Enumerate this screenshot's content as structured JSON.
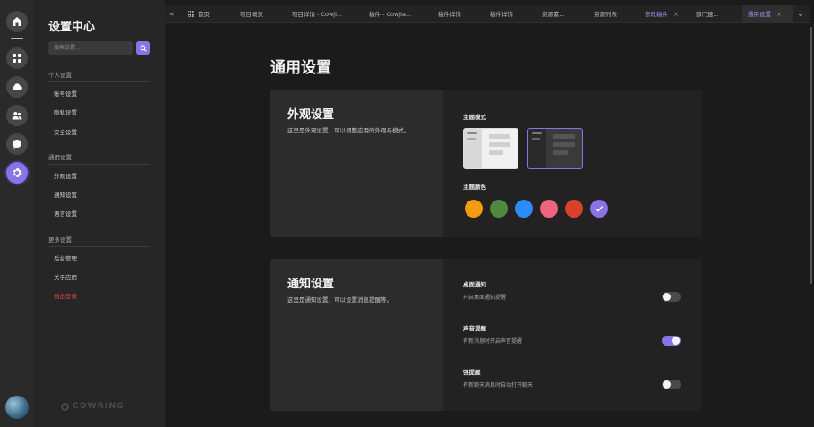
{
  "sidebar_rail": {
    "items": [
      {
        "name": "home-icon"
      },
      {
        "name": "grid-icon"
      },
      {
        "name": "cloud-icon"
      },
      {
        "name": "users-icon"
      },
      {
        "name": "chat-icon"
      },
      {
        "name": "gear-icon",
        "active": true
      }
    ]
  },
  "panel": {
    "title": "设置中心",
    "search_placeholder": "搜索设置...",
    "groups": [
      {
        "title": "个人设置",
        "items": [
          "账号设置",
          "隐私设置",
          "安全设置"
        ]
      },
      {
        "title": "通用设置",
        "items": [
          "外观设置",
          "通知设置",
          "语言设置"
        ]
      },
      {
        "title": "更多设置",
        "items": [
          "后台管理",
          "关于应用",
          "退出登录"
        ]
      }
    ],
    "brand": "COWRING"
  },
  "tabs": [
    {
      "label": "首页"
    },
    {
      "label": "项目概览"
    },
    {
      "label": "项目详情 - Cowji..."
    },
    {
      "label": "稿件 - Cowjia..."
    },
    {
      "label": "稿件详情"
    },
    {
      "label": "稿件详情"
    },
    {
      "label": "资源素..."
    },
    {
      "label": "资源列表"
    },
    {
      "label": "修改稿件",
      "close": "×"
    },
    {
      "label": "部门速..."
    },
    {
      "label": "通用设置",
      "close": "×",
      "active": true
    }
  ],
  "page": {
    "title": "通用设置"
  },
  "appearance": {
    "title": "外观设置",
    "desc": "这里是外观设置，可以调整应用的外观与模式。",
    "theme_mode_label": "主题模式",
    "theme_modes": [
      "light",
      "dark"
    ],
    "selected_mode": "dark",
    "theme_color_label": "主题颜色",
    "colors": [
      "#f39c12",
      "#4f8a3f",
      "#2a8cff",
      "#f0657d",
      "#d9412b",
      "#8a73e6"
    ],
    "selected_color": "#8a73e6"
  },
  "notifications": {
    "title": "通知设置",
    "desc": "这里是通知设置，可以设置消息提醒等。",
    "items": [
      {
        "label": "桌面通知",
        "sub": "开启桌面通知提醒",
        "on": false
      },
      {
        "label": "声音提醒",
        "sub": "有新消息时开启声音提醒",
        "on": true
      },
      {
        "label": "强提醒",
        "sub": "有新聊天消息时自动打开聊天",
        "on": false
      }
    ]
  }
}
